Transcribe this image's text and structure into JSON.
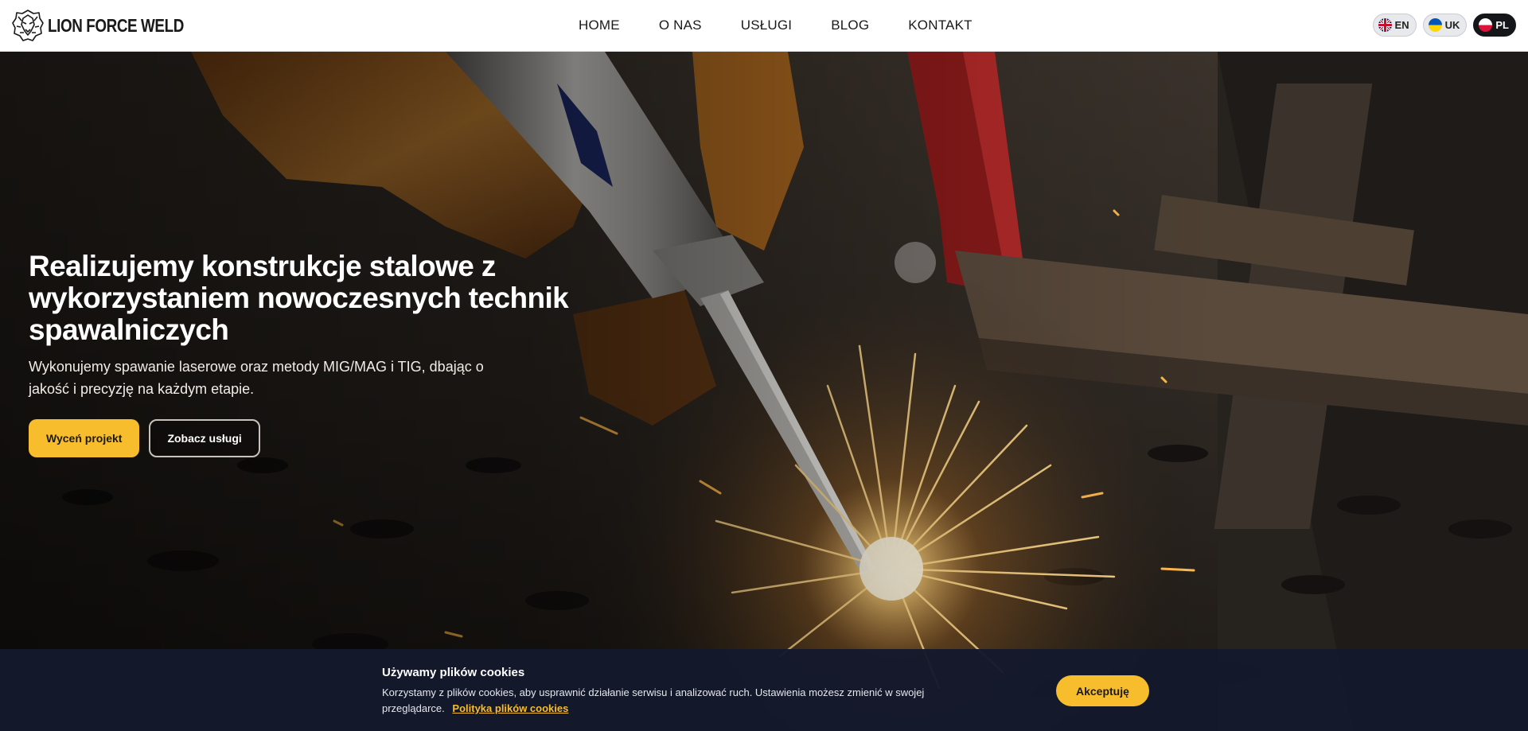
{
  "brand": {
    "logo_text": "LION FORCE WELD",
    "accent_color": "#f8bd2c",
    "header_bg": "#ffffff"
  },
  "nav": {
    "items": [
      {
        "label": "HOME"
      },
      {
        "label": "O NAS"
      },
      {
        "label": "USŁUGI"
      },
      {
        "label": "BLOG"
      },
      {
        "label": "KONTAKT"
      }
    ]
  },
  "languages": {
    "items": [
      {
        "code": "EN",
        "flag": "uk-flag-icon"
      },
      {
        "code": "UK",
        "flag": "ukraine-flag-icon"
      },
      {
        "code": "PL",
        "flag": "poland-flag-icon",
        "active": true
      }
    ]
  },
  "hero": {
    "title": "Realizujemy konstrukcje stalowe z wykorzystaniem nowoczesnych technik spawalniczych",
    "subtitle": "Wykonujemy spawanie laserowe oraz metody MIG/MAG i TIG, dbając o jakość i precyzję na każdym etapie.",
    "primary_button": "Wyceń projekt",
    "secondary_button": "Zobacz usługi"
  },
  "cookie_banner": {
    "title": "Używamy plików cookies",
    "body": "Korzystamy z plików cookies, aby usprawnić działanie serwisu i analizować ruch. Ustawienia możesz zmienić w swojej przeglądarce.",
    "link_label": "Polityka plików cookies",
    "accept_label": "Akceptuję",
    "bg_color": "#14192c"
  }
}
